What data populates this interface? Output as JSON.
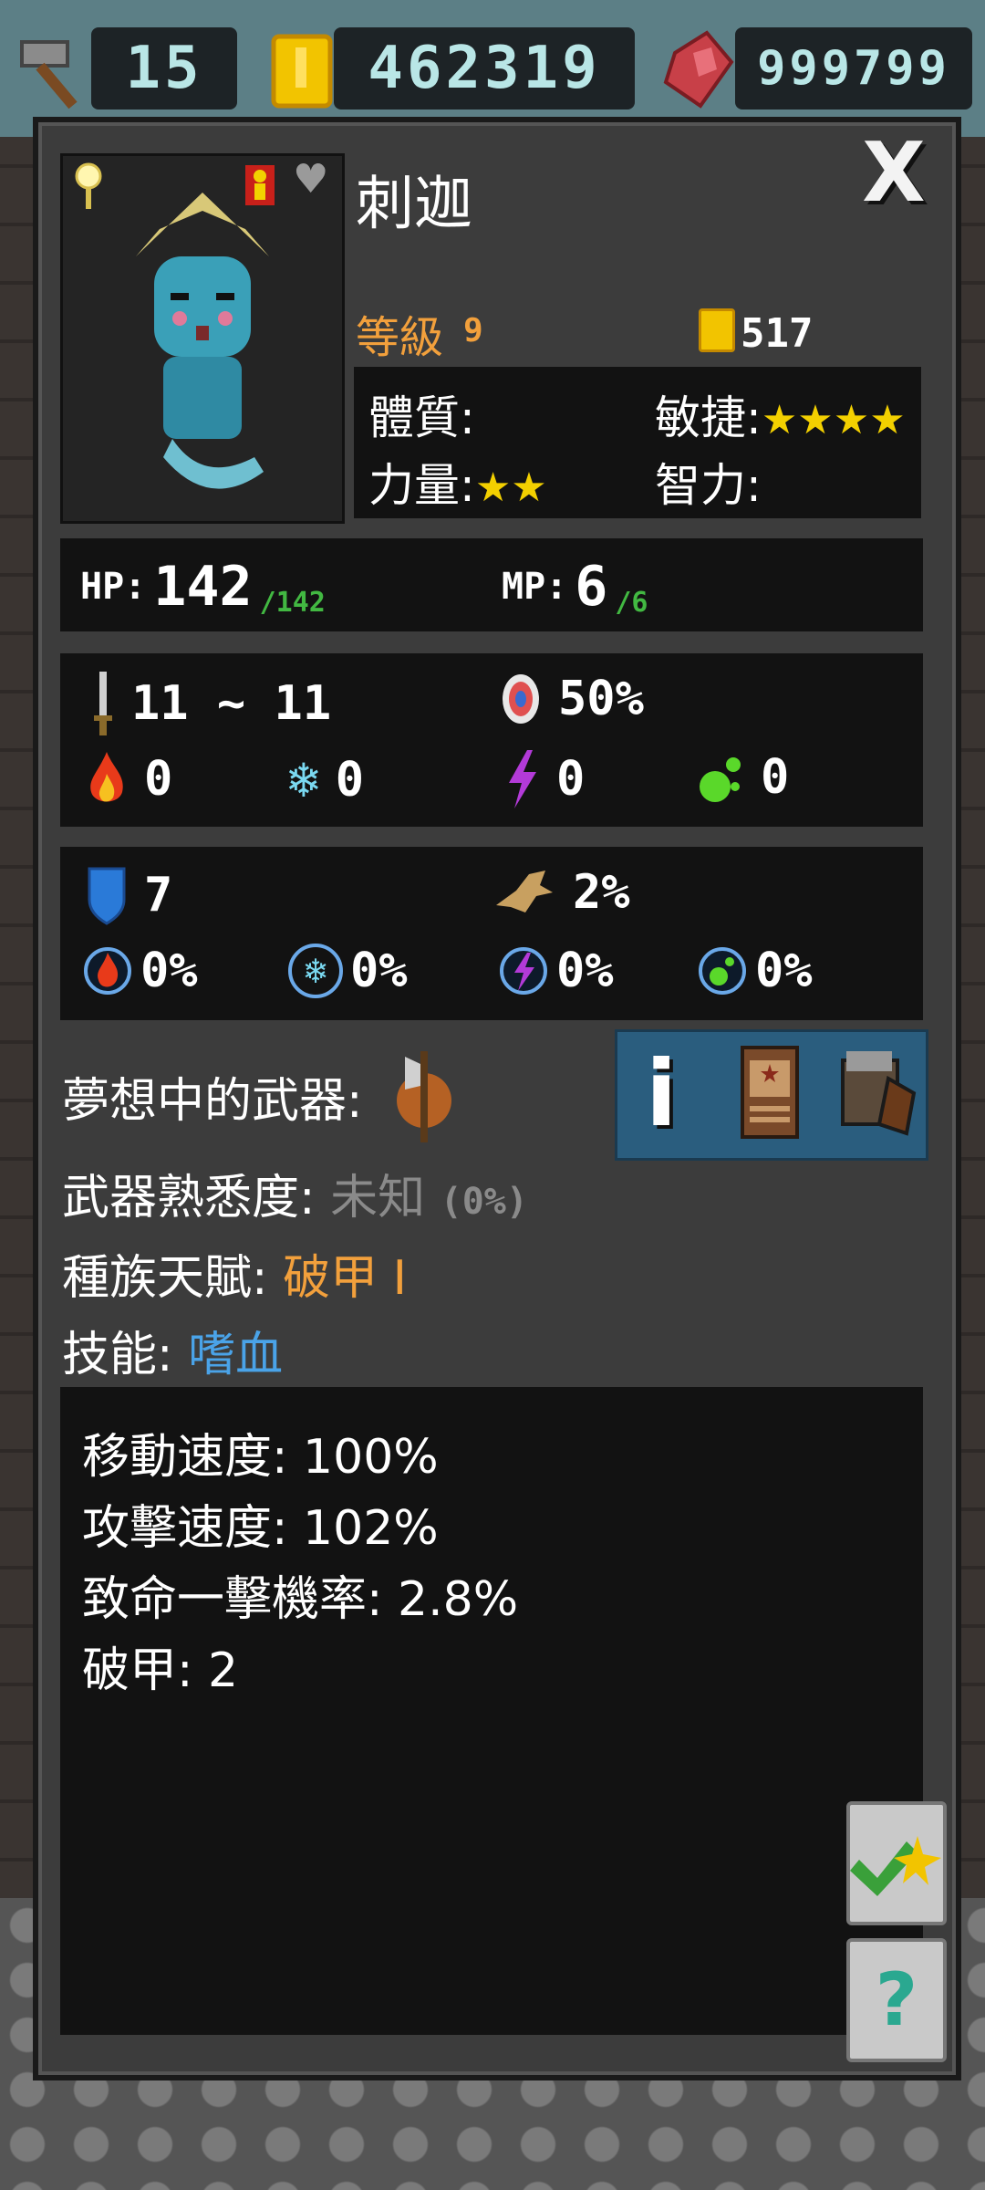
{
  "resources": [
    {
      "icon": "hammer-icon",
      "value": "15"
    },
    {
      "icon": "gold-coin-icon",
      "value": "462319"
    },
    {
      "icon": "red-gem-icon",
      "value": "999799"
    }
  ],
  "character": {
    "name": "刺迦",
    "level_label": "等級",
    "level_value": "9",
    "gold": "517",
    "attributes": {
      "con_label": "體質:",
      "agi_label": "敏捷:",
      "agi_stars": "★★★★",
      "str_label": "力量:",
      "str_stars": "★★",
      "int_label": "智力:"
    },
    "hp_label": "HP:",
    "hp": "142",
    "hp_max": "/142",
    "mp_label": "MP:",
    "mp": "6",
    "mp_max": "/6"
  },
  "offense": {
    "damage": "11 ~ 11",
    "accuracy": "50%",
    "fire": "0",
    "ice": "0",
    "lightning": "0",
    "poison": "0"
  },
  "defense": {
    "armor": "7",
    "dodge": "2%",
    "fire_res": "0%",
    "ice_res": "0%",
    "lightning_res": "0%",
    "poison_res": "0%"
  },
  "info": {
    "dream_weapon_label": "夢想中的武器:",
    "familiarity_label": "武器熟悉度:",
    "familiarity_value": "未知",
    "familiarity_pct": "(0%)",
    "racial_label": "種族天賦:",
    "racial_value": "破甲 I",
    "skill_label": "技能:",
    "skill_value": "嗜血"
  },
  "details": [
    "移動速度: 100%",
    "攻擊速度: 102%",
    "致命一擊機率: 2.8%",
    "破甲: 2"
  ],
  "buttons": {
    "close": "X",
    "info": "i",
    "help": "?"
  },
  "colors": {
    "level": "#f2a03c",
    "skill": "#4aa3e8",
    "star": "#f3d000",
    "max_value": "#42b842"
  }
}
